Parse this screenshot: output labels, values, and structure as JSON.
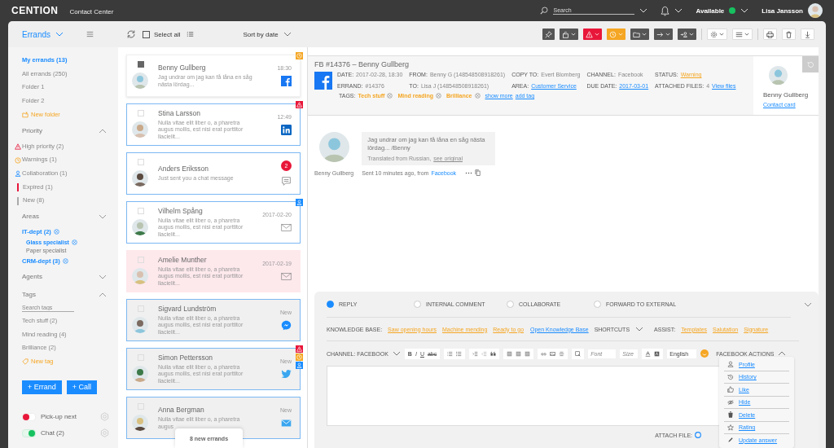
{
  "top_bar": {
    "logo": "CENTION",
    "subtitle": "Contact Center",
    "search": {
      "placeholder": "Search"
    },
    "status": {
      "label": "Available",
      "color": "#17c160"
    },
    "user": "Lisa Jansson"
  },
  "toolbar": {
    "view": "Errands",
    "select_all": {
      "label": "Select all",
      "checked": false
    },
    "sort": "Sort by date"
  },
  "sidebar": {
    "nav": [
      {
        "label": "My errands (13)",
        "selected": true
      },
      {
        "label": "All errands (250)",
        "selected": false
      },
      {
        "label": "Folder 1",
        "selected": false
      },
      {
        "label": "Folder 2",
        "selected": false
      }
    ],
    "new_folder": "New folder",
    "priority": {
      "title": "Priority",
      "expanded": true,
      "items": [
        {
          "label": "High priority (2)",
          "kind": "alert"
        },
        {
          "label": "Warnings (1)",
          "kind": "warning"
        },
        {
          "label": "Collaboration (1)",
          "kind": "collab"
        },
        {
          "label": "Expired (1)",
          "kind": "expired"
        },
        {
          "label": "New (8)",
          "kind": "new"
        }
      ]
    },
    "areas": {
      "title": "Areas",
      "expanded": false,
      "items": [
        {
          "label": "IT-dept (2)",
          "selected": true,
          "children": [
            {
              "label": "Glass specialist",
              "selected": true
            },
            {
              "label": "Paper specialist",
              "selected": false
            }
          ]
        },
        {
          "label": "CRM-dept (3)",
          "selected": true
        }
      ]
    },
    "agents": {
      "title": "Agents",
      "expanded": false
    },
    "tags": {
      "title": "Tags",
      "expanded": true,
      "search_placeholder": "Search tags",
      "items": [
        "Tech stuff (2)",
        "Mind reading (4)",
        "Brilliance (2)"
      ],
      "new_tag": "New tag"
    },
    "buttons": [
      "+ Errand",
      "+ Call"
    ],
    "toggles": [
      {
        "label": "Pick-up next",
        "on": false,
        "color": "#e8173a"
      },
      {
        "label": "Chat (2)",
        "on": true,
        "color": "#17c160"
      }
    ]
  },
  "errands": [
    {
      "name": "Benny Gullberg",
      "preview": "Jag undrar om jag kan få låna en såg nästa lördag...",
      "time": "18:30",
      "kind": "facebook",
      "checked": true,
      "selected": true,
      "expired": false,
      "unread": false,
      "high_priority": false,
      "warning": true,
      "collaboration": false
    },
    {
      "name": "Stina Larsson",
      "preview": "Nulla vitae elit liber o, a pharetra augus mollis, est nisi erat porttitor llacielit...",
      "time": "12:49",
      "kind": "linkedin",
      "checked": false,
      "selected": false,
      "expired": false,
      "unread": false,
      "high_priority": true,
      "warning": false,
      "collaboration": false
    },
    {
      "name": "Anders Eriksson",
      "preview": "Just sent you a chat message",
      "unread_count": "2",
      "kind": "chat",
      "checked": false,
      "selected": false,
      "expired": false,
      "unread": false,
      "high_priority": false,
      "warning": false,
      "collaboration": false
    },
    {
      "name": "Vilhelm Spång",
      "preview": "Nulla vitae elit liber o, a pharetra augus mollis, est nisi erat porttitor llacielit...",
      "time": "2017-02-20",
      "kind": "email",
      "checked": false,
      "selected": false,
      "expired": false,
      "unread": false,
      "high_priority": false,
      "warning": false,
      "collaboration": true
    },
    {
      "name": "Amelie Munther",
      "preview": "Nulla vitae elit liber o, a pharetra augus mollis, est nisi erat porttitor llacielit...",
      "time": "2017-02-19",
      "kind": "email",
      "checked": false,
      "selected": false,
      "expired": true,
      "unread": false,
      "high_priority": false,
      "warning": false,
      "collaboration": false
    },
    {
      "name": "Sigvard Lundström",
      "preview": "Nulla vitae elit liber o, a pharetra augus mollis, est nisi erat porttitor llacielit...",
      "time": "New",
      "kind": "messenger",
      "checked": false,
      "selected": false,
      "expired": false,
      "unread": true,
      "high_priority": false,
      "warning": false,
      "collaboration": false
    },
    {
      "name": "Simon Pettersson",
      "preview": "Nulla vitae elit liber o, a pharetra augus mollis, est nisi erat porttitor llacielit...",
      "time": "New",
      "kind": "twitter",
      "checked": false,
      "selected": false,
      "expired": false,
      "unread": true,
      "high_priority": true,
      "warning": true,
      "collaboration": true
    },
    {
      "name": "Anna Bergman",
      "preview": "Nulla vitae elit liber o, a pharetra augus",
      "time": "New",
      "kind": "email-filled",
      "checked": false,
      "selected": false,
      "expired": false,
      "unread": true,
      "high_priority": false,
      "warning": false,
      "collaboration": false
    }
  ],
  "new_errands_notice": "8 new errands",
  "errand": {
    "title": "FB #14376 – Benny Gullberg",
    "fields": [
      {
        "label": "DATE:",
        "value": "2017-02-28, 18:30",
        "kind": "plain"
      },
      {
        "label": "FROM:",
        "value": "Benny G (148548508918261)",
        "kind": "plain"
      },
      {
        "label": "COPY TO:",
        "value": "Evert Blomberg",
        "kind": "plain"
      },
      {
        "label": "CHANNEL:",
        "value": "Facebook",
        "kind": "plain"
      },
      {
        "label": "STATUS:",
        "value": "Warning",
        "kind": "warning"
      },
      {
        "label": "ERRAND:",
        "value": "#14376",
        "kind": "plain"
      },
      {
        "label": "TO:",
        "value": "Lisa J (148548508918261)",
        "kind": "plain"
      },
      {
        "label": "AREA:",
        "value": "Customer Service",
        "kind": "link"
      },
      {
        "label": "DUE DATE:",
        "value": "2017-03-01",
        "kind": "link"
      },
      {
        "label": "ATTACHED FILES:",
        "value": "4",
        "link": "View files",
        "kind": "plain"
      }
    ],
    "tags_label": "TAGS:",
    "tags": [
      "Tech stuff",
      "Mind reading",
      "Brilliance"
    ],
    "show_more": "show more",
    "add_tag": "add tag",
    "contact": {
      "name": "Benny Gullberg",
      "link": "Contact card"
    }
  },
  "message": {
    "author": "Benny Gullberg",
    "text": "Jag undrar om jag kan få låna en såg nästa lördag... /Benny",
    "translation": "Translated from Russian,",
    "see_original": "see original",
    "sent": "Sent 10 minutes ago, from",
    "source": "Facebook"
  },
  "reply": {
    "modes": [
      {
        "label": "REPLY",
        "selected": true
      },
      {
        "label": "INTERNAL COMMENT",
        "selected": false
      },
      {
        "label": "COLLABORATE",
        "selected": false
      },
      {
        "label": "FORWARD TO EXTERNAL",
        "selected": false
      }
    ],
    "knowledge_base_label": "KNOWLEDGE BASE:",
    "knowledge_base": [
      "Saw opening hours",
      "Machine mending",
      "Ready to go"
    ],
    "open_knowledge_base": "Open Knowledge Base",
    "shortcuts": "SHORTCUTS",
    "assist_label": "ASSIST:",
    "assist": [
      "Templates",
      "Salutation",
      "Signature"
    ],
    "channel": "CHANNEL: FACEBOOK",
    "format_buttons": [
      "B",
      "I",
      "U",
      "abc"
    ],
    "font": "Font",
    "size": "Size",
    "language": "English",
    "facebook_actions": {
      "title": "FACEBOOK ACTIONS",
      "expanded": true,
      "items": [
        {
          "label": "Profile",
          "kind": "profile"
        },
        {
          "label": "History",
          "kind": "history"
        },
        {
          "label": "Like",
          "kind": "like"
        },
        {
          "label": "Hide",
          "kind": "hide"
        },
        {
          "label": "Delete",
          "kind": "delete"
        },
        {
          "label": "Rating",
          "kind": "rating"
        },
        {
          "label": "Update answer",
          "kind": "edit"
        }
      ]
    },
    "attach_label": "ATTACH FILE:"
  }
}
